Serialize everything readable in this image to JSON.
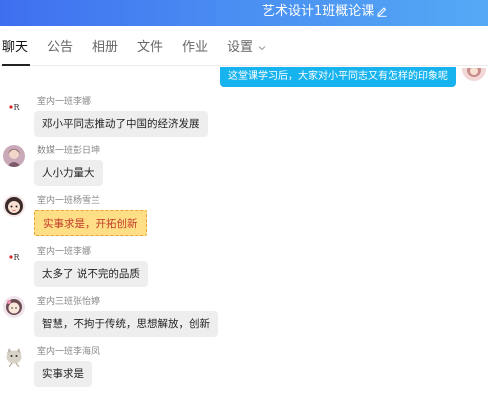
{
  "header": {
    "title": "艺术设计1班概论课",
    "edit_icon": "edit-pencil-icon",
    "gradient": [
      "#3f6ff0",
      "#54a9f5"
    ]
  },
  "tabs": [
    {
      "label": "聊天",
      "active": true
    },
    {
      "label": "公告"
    },
    {
      "label": "相册"
    },
    {
      "label": "文件"
    },
    {
      "label": "作业"
    },
    {
      "label": "设置"
    }
  ],
  "my_message": {
    "text": "这堂课学习后，大家对小平同志又有怎样的印象呢",
    "color": "#17b3ee"
  },
  "messages": [
    {
      "name": "室内一班李娜",
      "text": "邓小平同志推动了中国的经济发展",
      "avatar": "logo-avatar"
    },
    {
      "name": "数媒一班彭日坤",
      "text": "人小力量大",
      "avatar": "photo-avatar"
    },
    {
      "name": "室内一班杨雪兰",
      "text": "实事求是，开拓创新",
      "avatar": "cartoon-avatar"
    },
    {
      "name": "室内一班李娜",
      "text": "太多了 说不完的品质",
      "avatar": "logo-avatar"
    },
    {
      "name": "室内三班张怡婷",
      "text": "智慧，不拘于传统，思想解放，创新",
      "avatar": "girl-avatar"
    },
    {
      "name": "室内一班李海凤",
      "text": "实事求是",
      "avatar": "cat-avatar"
    }
  ]
}
